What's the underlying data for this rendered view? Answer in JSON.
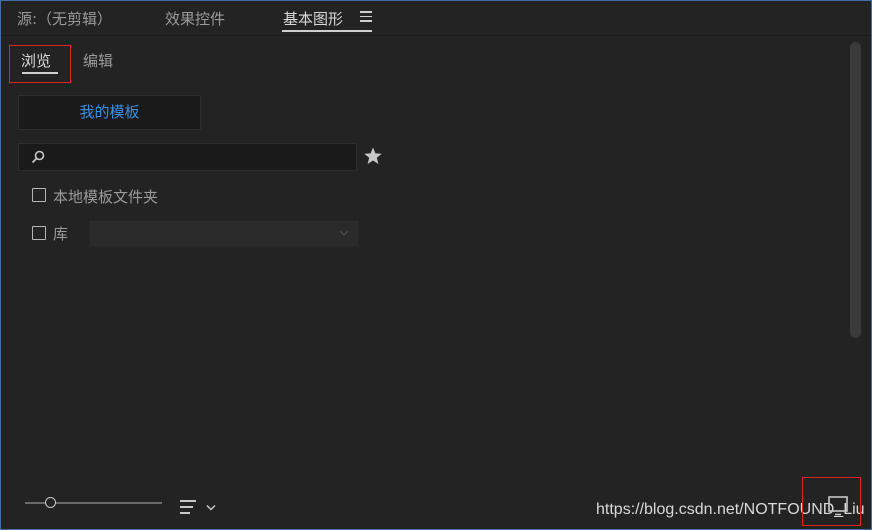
{
  "panel_tabs": [
    {
      "label": "源:（无剪辑）",
      "active": false
    },
    {
      "label": "效果控件",
      "active": false
    },
    {
      "label": "基本图形",
      "active": true
    }
  ],
  "panel_menu_icon": "hamburger-menu-icon",
  "sub_tabs": [
    {
      "label": "浏览",
      "active": true
    },
    {
      "label": "编辑",
      "active": false
    }
  ],
  "browse": {
    "my_templates_label": "我的模板",
    "search_value": "",
    "search_icon": "search-icon",
    "favorite_icon": "star-icon",
    "local_templates_folder_label": "本地模板文件夹",
    "local_templates_folder_checked": false,
    "library_label": "库",
    "library_checked": false,
    "library_selected": ""
  },
  "footer": {
    "zoom_slider_level": 0.15,
    "view_icon": "list-view-icon",
    "new_item_icon": "new-layer-icon"
  },
  "watermark": "https://blog.csdn.net/NOTFOUND_Liu",
  "colors": {
    "accent_link": "#3d8fe0",
    "highlight_box": "#e02424",
    "panel_bg": "#232323",
    "frame_border": "#3f6ea6"
  }
}
